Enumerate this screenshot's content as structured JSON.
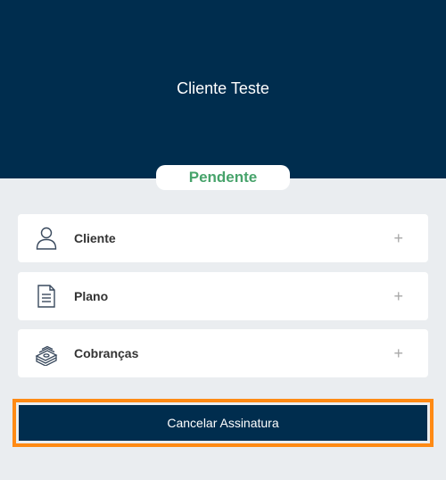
{
  "header": {
    "client_name": "Cliente Teste",
    "background_color": "#002d4e"
  },
  "status": {
    "label": "Pendente",
    "color": "#47a36b"
  },
  "sections": [
    {
      "label": "Cliente",
      "icon": "user-icon",
      "toggle": "+"
    },
    {
      "label": "Plano",
      "icon": "document-icon",
      "toggle": "+"
    },
    {
      "label": "Cobranças",
      "icon": "money-stack-icon",
      "toggle": "+"
    }
  ],
  "actions": {
    "cancel_label": "Cancelar Assinatura",
    "highlight_color": "#ff8a14"
  }
}
